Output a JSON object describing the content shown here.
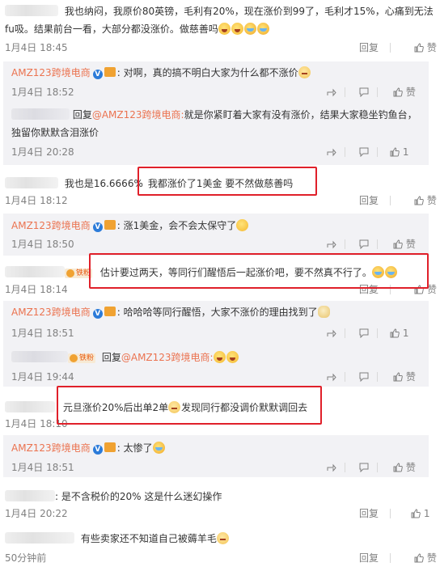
{
  "labels": {
    "reply": "回复",
    "like": "赞",
    "fan_badge": "铁粉",
    "verified_mark": "V",
    "reply_prefix": "回复",
    "mention": "@AMZ123跨境电商",
    "mention_colon": "@AMZ123跨境电商:"
  },
  "colors": {
    "link": "#eb7350",
    "meta": "#808080",
    "highlight": "#e0202a",
    "reply_bg": "#f2f2f5"
  },
  "comments": [
    {
      "text_line1": "我也纳闷，我原价80英镑，毛利有20%，现在涨价到99了，毛利才15%，心痛到无法",
      "text_line2": "fu吸。结果前台一看，大部分都没涨价。做慈善吗",
      "time": "1月4日 18:45",
      "replies": [
        {
          "author": "AMZ123跨境电商",
          "text": "对啊，真的搞不明白大家为什么都不涨价",
          "time": "1月4日 18:52"
        },
        {
          "text_line1": "就是你紧盯着大家有没有涨价，结果大家稳坐钓鱼台，",
          "text_line2": "独留你默默含泪涨价",
          "time": "1月4日 20:28",
          "like_count": "1"
        }
      ]
    },
    {
      "text_prefix": "我也是16.6666%",
      "text": "我都涨价了1美金 要不然做慈善吗",
      "time": "1月4日 18:12",
      "replies": [
        {
          "author": "AMZ123跨境电商",
          "text": "涨1美金，会不会太保守了",
          "time": "1月4日 18:50"
        }
      ]
    },
    {
      "text": "估计要过两天，等同行们醒悟后一起涨价吧，要不然真不行了。",
      "time": "1月4日 18:14",
      "replies": [
        {
          "author": "AMZ123跨境电商",
          "text": "哈哈哈等同行醒悟，大家不涨价的理由找到了",
          "time": "1月4日 18:51",
          "like_count": "1"
        },
        {
          "time": "1月4日 19:44"
        }
      ]
    },
    {
      "text_a": "元旦涨价20%后出单2单",
      "text_b": "发现同行都没调价默默调回去",
      "time": "1月4日 18:10",
      "replies": [
        {
          "author": "AMZ123跨境电商",
          "text": "太惨了",
          "time": "1月4日 18:51"
        }
      ]
    },
    {
      "text": "是不含税价的20% 这是什么迷幻操作",
      "time": "1月4日 20:22",
      "like_count": "1"
    },
    {
      "text": "有些卖家还不知道自己被薅羊毛",
      "time": "50分钟前"
    }
  ]
}
